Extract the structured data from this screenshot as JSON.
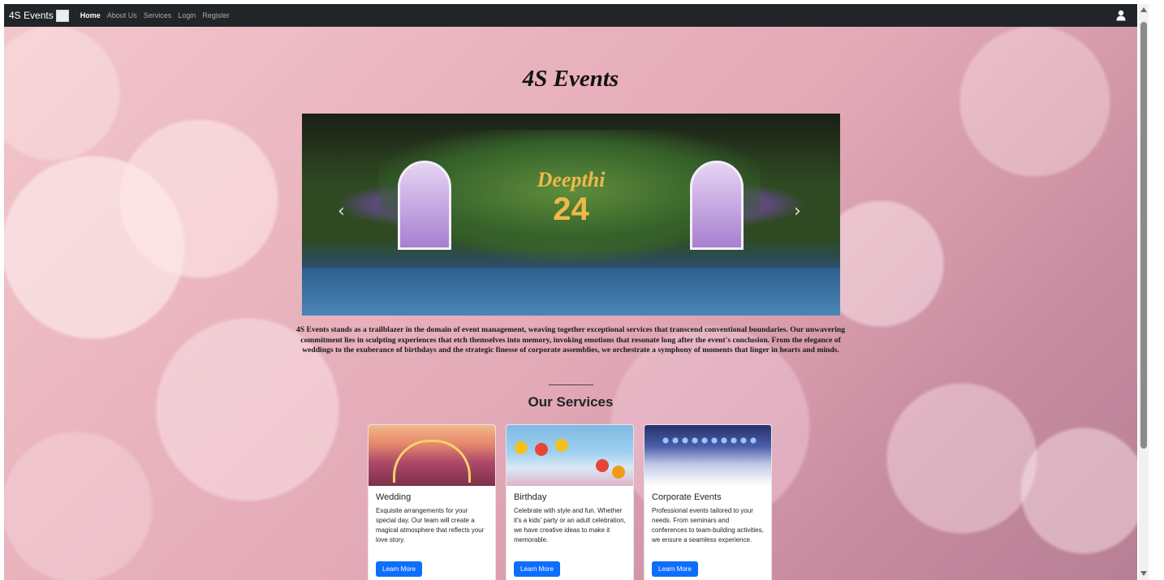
{
  "navbar": {
    "brand": "4S Events",
    "links": [
      "Home",
      "About Us",
      "Services",
      "Login",
      "Register"
    ],
    "active": "Home",
    "user_icon": "user-icon"
  },
  "hero": {
    "title": "4S Events",
    "carousel": {
      "overlay_name": "Deepthi",
      "overlay_number": "24",
      "prev_icon": "chevron-left-icon",
      "next_icon": "chevron-right-icon"
    },
    "description": "4S Events stands as a trailblazer in the domain of event management, weaving together exceptional services that transcend conventional boundaries. Our unwavering commitment lies in sculpting experiences that etch themselves into memory, invoking emotions that resonate long after the event's conclusion. From the elegance of weddings to the exuberance of birthdays and the strategic finesse of corporate assemblies, we orchestrate a symphony of moments that linger in hearts and minds."
  },
  "services": {
    "title": "Our Services",
    "cards": [
      {
        "title": "Wedding",
        "text": "Exquisite arrangements for your special day. Our team will create a magical atmosphere that reflects your love story.",
        "button": "Learn More"
      },
      {
        "title": "Birthday",
        "text": "Celebrate with style and fun. Whether it's a kids' party or an adult celebration, we have creative ideas to make it memorable.",
        "button": "Learn More"
      },
      {
        "title": "Corporate Events",
        "text": "Professional events tailored to your needs. From seminars and conferences to team-building activities, we ensure a seamless experience.",
        "button": "Learn More"
      }
    ]
  },
  "colors": {
    "navbar_bg": "#212529",
    "primary_button": "#0d6efd",
    "background_pink": "#e2a8b6"
  }
}
